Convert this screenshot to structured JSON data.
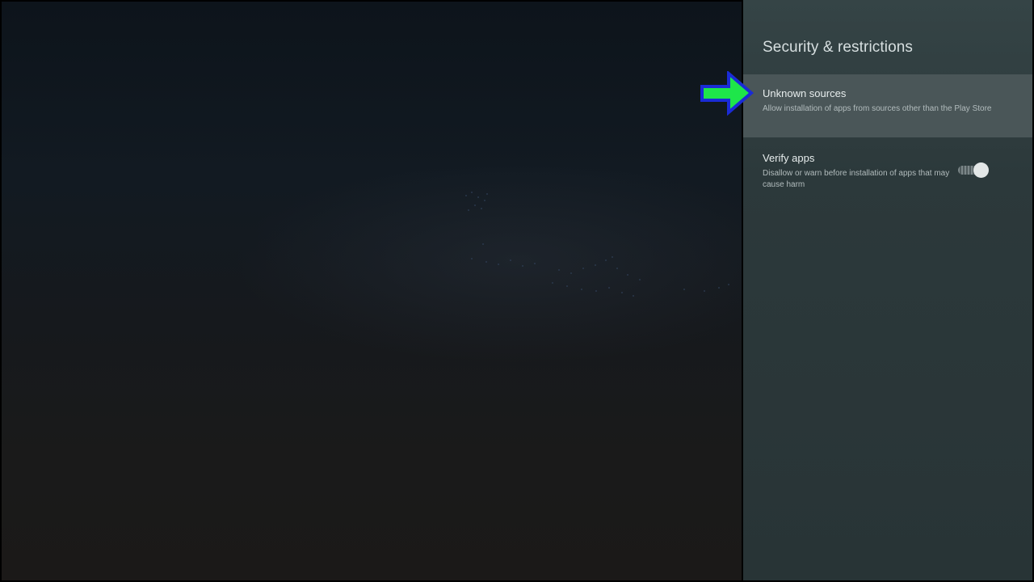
{
  "panel": {
    "title": "Security & restrictions",
    "items": [
      {
        "title": "Unknown sources",
        "description": "Allow installation of apps from sources other than the Play Store",
        "focused": true
      },
      {
        "title": "Verify apps",
        "description": "Disallow or warn before installation of apps that may cause harm",
        "toggle": "on"
      }
    ]
  },
  "annotation": {
    "icon": "green-arrow-icon",
    "color": "#1ee64a",
    "outline": "#1a2bd6"
  },
  "colors": {
    "panel_bg": "#2c393b",
    "focus_bg": "#4a5658",
    "title_text": "#d7dfe0"
  }
}
